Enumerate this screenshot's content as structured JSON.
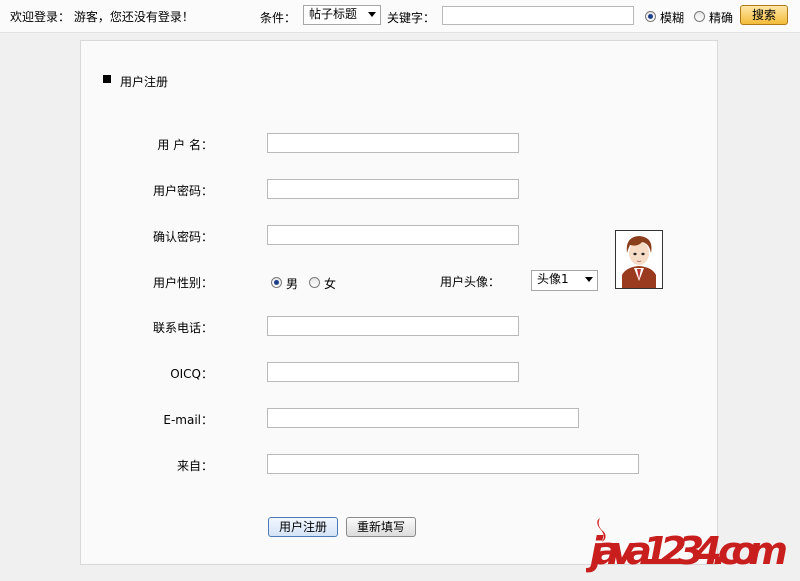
{
  "topbar": {
    "welcome": "欢迎登录：  游客，您还没有登录！",
    "condition_label": "条件：",
    "condition_value": "帖子标题",
    "keyword_label": "关键字：",
    "keyword_value": "",
    "fuzzy_label": "模糊",
    "exact_label": "精确",
    "search_label": "搜索",
    "selected_mode": "fuzzy"
  },
  "section": {
    "title": "用户注册"
  },
  "form": {
    "username_label": "用 户 名：",
    "password_label": "用户密码：",
    "confirm_label": "确认密码：",
    "gender_label": "用户性别：",
    "male_label": "男",
    "female_label": "女",
    "selected_gender": "male",
    "avatar_label": "用户头像：",
    "avatar_value": "头像1",
    "phone_label": "联系电话：",
    "oicq_label": "OICQ：",
    "email_label": "E-mail：",
    "from_label": "来自："
  },
  "buttons": {
    "register": "用户注册",
    "reset": "重新填写"
  },
  "watermark": {
    "text": "java1234.com"
  },
  "colors": {
    "search_button": "#f3bb3a",
    "watermark_red": "#c81e1e"
  }
}
